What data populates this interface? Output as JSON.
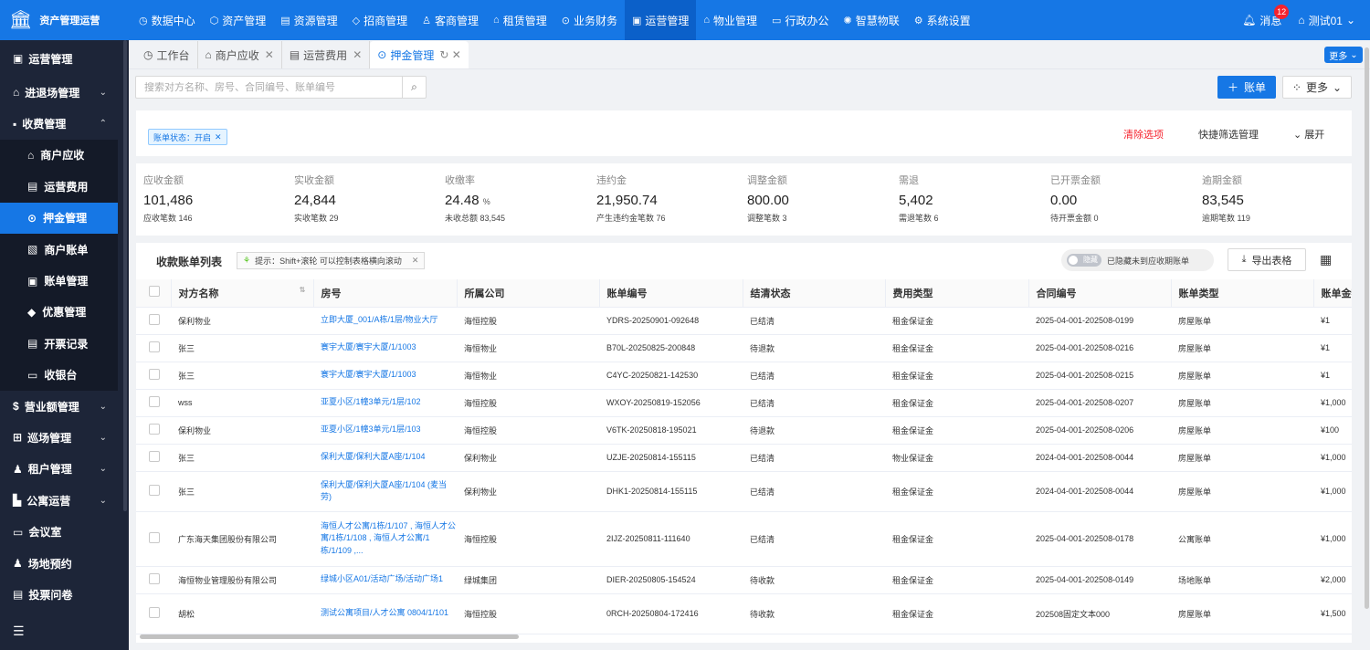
{
  "app": {
    "title": "资产管理运营"
  },
  "topnav": [
    {
      "icon": "◷",
      "label": "数据中心"
    },
    {
      "icon": "⬡",
      "label": "资产管理"
    },
    {
      "icon": "▤",
      "label": "资源管理"
    },
    {
      "icon": "◇",
      "label": "招商管理"
    },
    {
      "icon": "♙",
      "label": "客商管理"
    },
    {
      "icon": "⌂",
      "label": "租赁管理"
    },
    {
      "icon": "⊙",
      "label": "业务财务"
    },
    {
      "icon": "▣",
      "label": "运营管理",
      "active": true
    },
    {
      "icon": "⌂",
      "label": "物业管理"
    },
    {
      "icon": "▭",
      "label": "行政办公"
    },
    {
      "icon": "✺",
      "label": "智慧物联"
    },
    {
      "icon": "⚙",
      "label": "系统设置"
    }
  ],
  "header": {
    "messages_label": "消息",
    "messages_count": "12",
    "user": "测试01"
  },
  "sidebar": {
    "module": "运营管理",
    "groups": [
      {
        "icon": "⌂",
        "label": "进退场管理",
        "chev": "⌄"
      },
      {
        "icon": "▪",
        "label": "收费管理",
        "chev": "⌃"
      }
    ],
    "sub": [
      {
        "icon": "⌂",
        "label": "商户应收"
      },
      {
        "icon": "▤",
        "label": "运营费用"
      },
      {
        "icon": "⊙",
        "label": "押金管理",
        "active": true
      },
      {
        "icon": "▧",
        "label": "商户账单"
      },
      {
        "icon": "▣",
        "label": "账单管理"
      },
      {
        "icon": "◆",
        "label": "优惠管理"
      },
      {
        "icon": "▤",
        "label": "开票记录"
      },
      {
        "icon": "▭",
        "label": "收银台"
      }
    ],
    "groups2": [
      {
        "icon": "$",
        "label": "营业额管理",
        "chev": "⌄"
      },
      {
        "icon": "⊞",
        "label": "巡场管理",
        "chev": "⌄"
      },
      {
        "icon": "♟",
        "label": "租户管理",
        "chev": "⌄"
      },
      {
        "icon": "▙",
        "label": "公寓运营",
        "chev": "⌄"
      },
      {
        "icon": "▭",
        "label": "会议室",
        "chev": ""
      },
      {
        "icon": "♟",
        "label": "场地预约",
        "chev": ""
      },
      {
        "icon": "▤",
        "label": "投票问卷",
        "chev": ""
      }
    ]
  },
  "tabs": [
    {
      "icon": "◷",
      "label": "工作台",
      "close": ""
    },
    {
      "icon": "⌂",
      "label": "商户应收",
      "close": "✕"
    },
    {
      "icon": "▤",
      "label": "运营费用",
      "close": "✕"
    },
    {
      "icon": "⊙",
      "label": "押金管理",
      "close": "↻ ✕",
      "active": true
    }
  ],
  "tabs_more": "更多",
  "search": {
    "placeholder": "搜索对方名称、房号、合同编号、账单编号"
  },
  "actions": {
    "add_label": "账单",
    "more_label": "更多"
  },
  "filter": {
    "tag": "账单状态：开启",
    "clear": "清除选项",
    "quick": "快捷筛选管理",
    "expand": "展开"
  },
  "stats": [
    {
      "label": "应收金额",
      "value": "101,486",
      "unit": "",
      "sub": "应收笔数 146"
    },
    {
      "label": "实收金额",
      "value": "24,844",
      "unit": "",
      "sub": "实收笔数 29"
    },
    {
      "label": "收缴率",
      "value": "24.48",
      "unit": "%",
      "sub": "未收总额 83,545"
    },
    {
      "label": "违约金",
      "value": "21,950.74",
      "unit": "",
      "sub": "产生违约金笔数 76"
    },
    {
      "label": "调整金额",
      "value": "800.00",
      "unit": "",
      "sub": "调整笔数 3"
    },
    {
      "label": "需退",
      "value": "5,402",
      "unit": "",
      "sub": "需退笔数 6"
    },
    {
      "label": "已开票金额",
      "value": "0.00",
      "unit": "",
      "sub": "待开票金额 0"
    },
    {
      "label": "逾期金额",
      "value": "83,545",
      "unit": "",
      "sub": "逾期笔数 119"
    }
  ],
  "table": {
    "title": "收款账单列表",
    "hint": "提示：Shift+滚轮 可以控制表格横向滚动",
    "toggle_label": "隐藏",
    "toggle_text": "已隐藏未到应收期账单",
    "export": "导出表格",
    "columns": [
      "对方名称",
      "房号",
      "所属公司",
      "账单编号",
      "结清状态",
      "费用类型",
      "合同编号",
      "账单类型",
      "账单金额"
    ],
    "rows": [
      {
        "name": "保利物业",
        "room": "立即大厦_001/A栋/1层/物业大厅",
        "company": "海恒控股",
        "bill": "YDRS-20250901-092648",
        "status": "已结清",
        "fee": "租金保证金",
        "contract": "2025-04-001-202508-0199",
        "type": "房屋账单",
        "amount": "¥1"
      },
      {
        "name": "张三",
        "room": "寰宇大厦/寰宇大厦/1/1003",
        "company": "海恒物业",
        "bill": "B70L-20250825-200848",
        "status": "待退款",
        "fee": "租金保证金",
        "contract": "2025-04-001-202508-0216",
        "type": "房屋账单",
        "amount": "¥1"
      },
      {
        "name": "张三",
        "room": "寰宇大厦/寰宇大厦/1/1003",
        "company": "海恒物业",
        "bill": "C4YC-20250821-142530",
        "status": "已结清",
        "fee": "租金保证金",
        "contract": "2025-04-001-202508-0215",
        "type": "房屋账单",
        "amount": "¥1"
      },
      {
        "name": "wss",
        "room": "亚夏小区/1幢3单元/1层/102",
        "company": "海恒控股",
        "bill": "WXOY-20250819-152056",
        "status": "已结清",
        "fee": "租金保证金",
        "contract": "2025-04-001-202508-0207",
        "type": "房屋账单",
        "amount": "¥1,000"
      },
      {
        "name": "保利物业",
        "room": "亚夏小区/1幢3单元/1层/103",
        "company": "海恒控股",
        "bill": "V6TK-20250818-195021",
        "status": "待退款",
        "fee": "租金保证金",
        "contract": "2025-04-001-202508-0206",
        "type": "房屋账单",
        "amount": "¥100"
      },
      {
        "name": "张三",
        "room": "保利大厦/保利大厦A座/1/104",
        "company": "保利物业",
        "bill": "UZJE-20250814-155115",
        "status": "已结清",
        "fee": "物业保证金",
        "contract": "2024-04-001-202508-0044",
        "type": "房屋账单",
        "amount": "¥1,000"
      },
      {
        "name": "张三",
        "room": "保利大厦/保利大厦A座/1/104 (麦当劳)",
        "company": "保利物业",
        "bill": "DHK1-20250814-155115",
        "status": "已结清",
        "fee": "租金保证金",
        "contract": "2024-04-001-202508-0044",
        "type": "房屋账单",
        "amount": "¥1,000"
      },
      {
        "name": "广东海天集团股份有限公司",
        "room": "海恒人才公寓/1栋/1/107 , 海恒人才公寓/1栋/1/108 , 海恒人才公寓/1栋/1/109 ,...",
        "company": "海恒控股",
        "bill": "2IJZ-20250811-111640",
        "status": "已结清",
        "fee": "租金保证金",
        "contract": "2025-04-001-202508-0178",
        "type": "公寓账单",
        "amount": "¥1,000"
      },
      {
        "name": "海恒物业管理股份有限公司",
        "room": "绿城小区A01/活动广场/活动广场1",
        "company": "绿城集团",
        "bill": "DIER-20250805-154524",
        "status": "待收款",
        "fee": "租金保证金",
        "contract": "2025-04-001-202508-0149",
        "type": "场地账单",
        "amount": "¥2,000"
      },
      {
        "name": "胡松",
        "room": "测试公寓项目/人才公寓 0804/1/101",
        "company": "海恒控股",
        "bill": "0RCH-20250804-172416",
        "status": "待收款",
        "fee": "租金保证金",
        "contract": "202508固定文本000",
        "type": "房屋账单",
        "amount": "¥1,500"
      }
    ]
  }
}
